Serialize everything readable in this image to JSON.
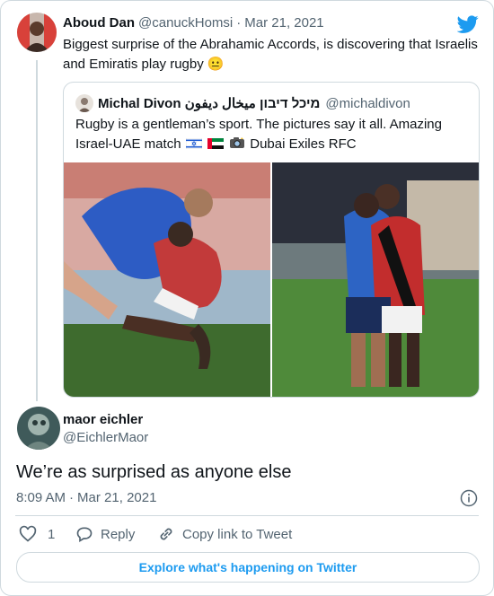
{
  "colors": {
    "accent": "#1d9bf0",
    "text": "#0f1419",
    "muted": "#536471",
    "border": "#cfd9de"
  },
  "parent_tweet": {
    "name": "Aboud Dan",
    "handle": "@canuckHomsi",
    "separator": "·",
    "date": "Mar 21, 2021",
    "text": "Biggest surprise of the Abrahamic Accords, is discovering that Israelis and Emiratis play rugby",
    "emoji": "😐"
  },
  "quoted_tweet": {
    "name": "Michal Divon מיכל דיבון ميخال ديفون",
    "handle": "@michaldivon",
    "text_line1": "Rugby is a gentleman’s sport. The pictures say it all. Amazing",
    "text_line2_a": "Israel-UAE match",
    "text_line2_b": "Dubai Exiles RFC",
    "flag_icons": [
      "israel-flag-icon",
      "uae-flag-icon",
      "camera-flash-icon"
    ]
  },
  "reply": {
    "name": "maor eichler",
    "handle": "@EichlerMaor",
    "text": "We’re as surprised as anyone else",
    "time": "8:09 AM",
    "separator": "·",
    "date": "Mar 21, 2021"
  },
  "actions": {
    "like_count": "1",
    "reply_label": "Reply",
    "copy_link_label": "Copy link to Tweet"
  },
  "footer": {
    "explore_label": "Explore what's happening on Twitter"
  }
}
